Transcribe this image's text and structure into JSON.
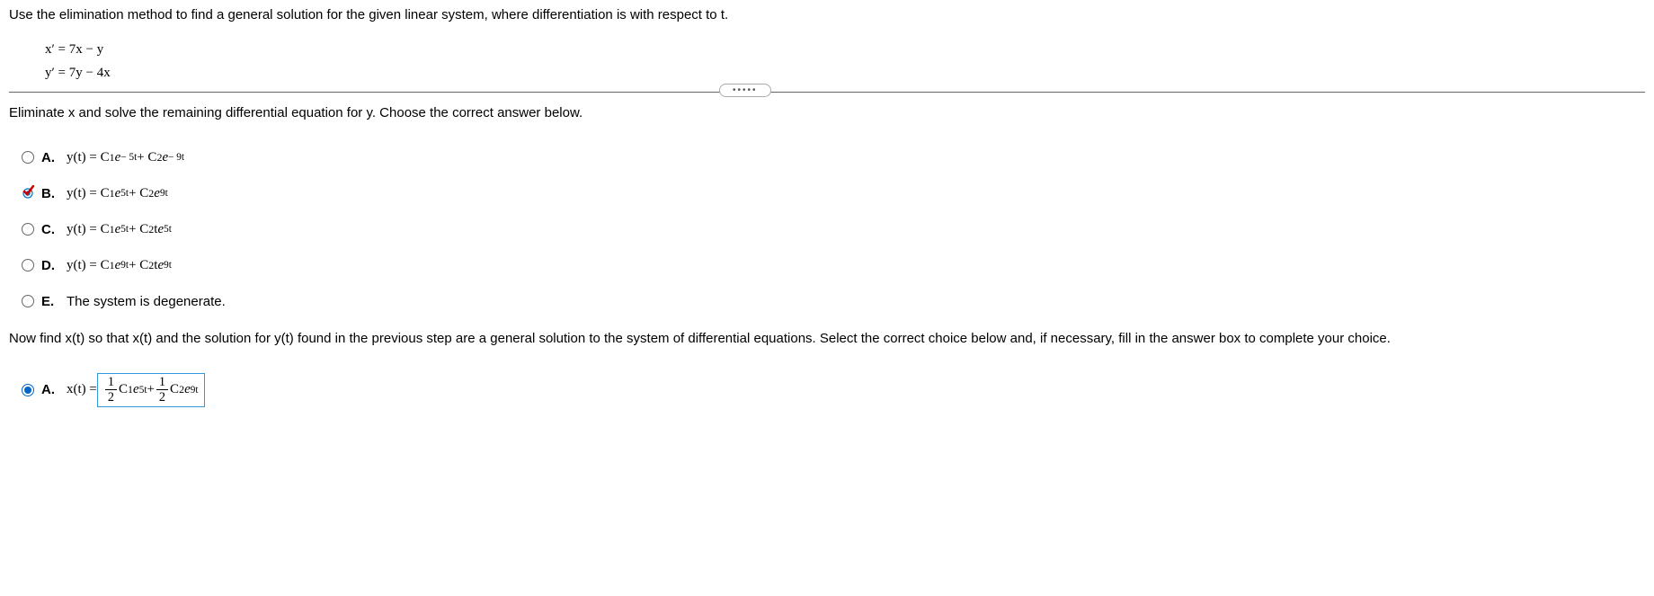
{
  "header": {
    "prompt": "Use the elimination method to find a general solution for the given linear system, where differentiation is with respect to t.",
    "eq1": "x′  =  7x − y",
    "eq2": "y′  =  7y − 4x"
  },
  "part1": {
    "instruction": "Eliminate x and solve the remaining differential equation for y. Choose the correct answer below.",
    "choices": {
      "A": {
        "letter": "A.",
        "prefix": "y(t) = C",
        "exp1": " − 5t",
        "mid": " + C",
        "exp2": " − 9t"
      },
      "B": {
        "letter": "B.",
        "prefix": "y(t) = C",
        "exp1": " 5t",
        "mid": " + C",
        "exp2": " 9t"
      },
      "C": {
        "letter": "C.",
        "prefix": "y(t) = C",
        "exp1": " 5t",
        "mid": " + C",
        "post": "t ",
        "exp2": " 5t"
      },
      "D": {
        "letter": "D.",
        "prefix": "y(t) = C",
        "exp1": " 9t",
        "mid": " + C",
        "post": "t ",
        "exp2": " 9t"
      },
      "E": {
        "letter": "E.",
        "text": "The system is degenerate."
      }
    }
  },
  "part2": {
    "instruction": "Now find x(t) so that x(t) and the solution for y(t) found in the previous step are a general solution to the system of differential equations. Select the correct choice below and, if necessary, fill in the answer box to complete your choice.",
    "choiceA": {
      "letter": "A.",
      "prefix": "x(t) = ",
      "frac1_num": "1",
      "frac1_den": "2",
      "term1_c": "C",
      "term1_sub": "1",
      "term1_e": " e",
      "term1_exp": " 5t",
      "plus": " + ",
      "frac2_num": "1",
      "frac2_den": "2",
      "term2_c": "C",
      "term2_sub": "2",
      "term2_e": " e",
      "term2_exp": " 9t"
    },
    "cutoff": "The system is degenerate"
  },
  "labels": {
    "sub1": "1",
    "sub2": "2",
    "e": " e"
  }
}
